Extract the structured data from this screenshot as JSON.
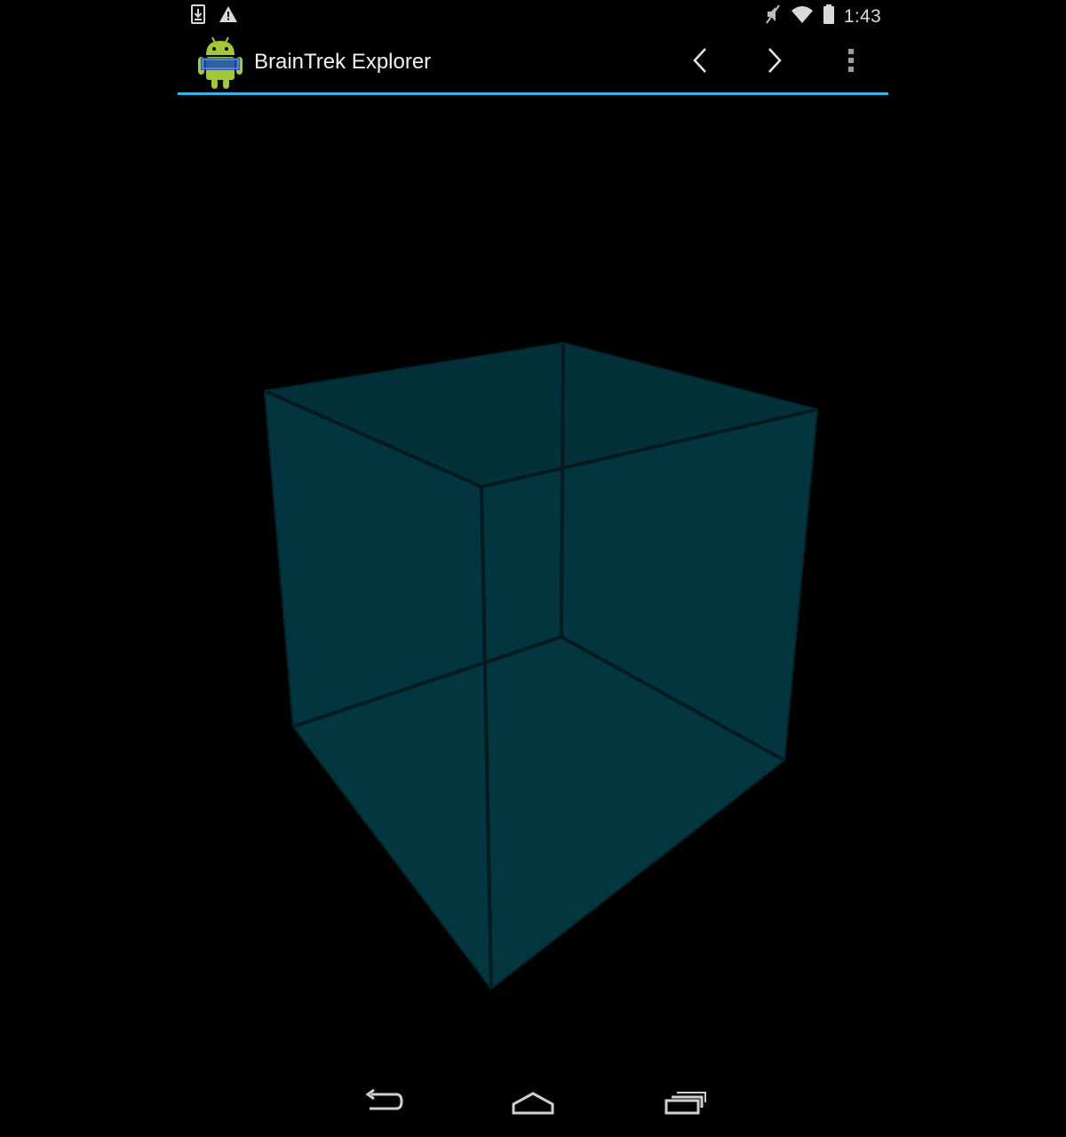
{
  "status_bar": {
    "time": "1:43",
    "icons": [
      "download-icon",
      "warning-icon",
      "mute-icon",
      "wifi-icon",
      "battery-icon"
    ]
  },
  "action_bar": {
    "title": "BrainTrek Explorer",
    "app_icon": "android-app-icon",
    "actions": [
      "chevron-left-icon",
      "chevron-right-icon",
      "overflow-menu-icon"
    ],
    "accent_color": "#33b5e5"
  },
  "viewport": {
    "object": "cube",
    "face_color": "#023640",
    "edge_color": "#011b20"
  },
  "nav_bar": {
    "buttons": [
      "back-icon",
      "home-icon",
      "recents-icon"
    ]
  }
}
